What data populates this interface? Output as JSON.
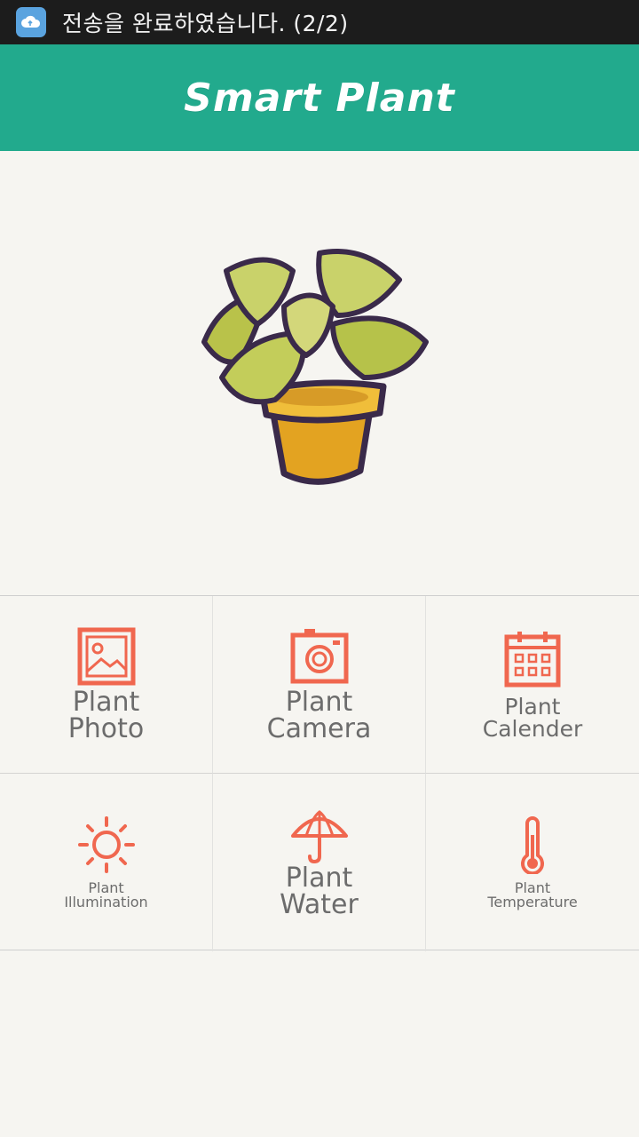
{
  "status_bar": {
    "notification_text": "전송을 완료하였습니다. (2/2)",
    "icon": "cloud-upload-icon"
  },
  "app_bar": {
    "title": "Smart Plant",
    "background": "#22aa8d"
  },
  "hero": {
    "image": "potted-plant-illustration"
  },
  "accent_color": "#f0674f",
  "menu": [
    {
      "line1": "Plant",
      "line2": "Photo",
      "icon": "photo-icon"
    },
    {
      "line1": "Plant",
      "line2": "Camera",
      "icon": "camera-icon"
    },
    {
      "line1": "Plant",
      "line2": "Calender",
      "icon": "calendar-icon"
    },
    {
      "line1": "Plant",
      "line2": "Illumination",
      "icon": "sun-icon"
    },
    {
      "line1": "Plant",
      "line2": "Water",
      "icon": "umbrella-icon"
    },
    {
      "line1": "Plant",
      "line2": "Temperature",
      "icon": "thermometer-icon"
    }
  ]
}
